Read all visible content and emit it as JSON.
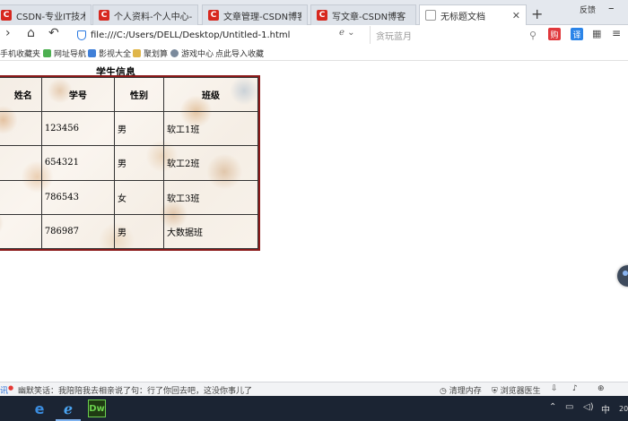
{
  "browser": {
    "tabs": [
      {
        "title": "CSDN-专业IT技术社区",
        "icon": "csdn-logo-icon",
        "active": false
      },
      {
        "title": "个人资料-个人中心-CSI",
        "icon": "csdn-logo-icon",
        "active": false
      },
      {
        "title": "文章管理-CSDN博客",
        "icon": "csdn-logo-icon",
        "active": false
      },
      {
        "title": "写文章-CSDN博客",
        "icon": "csdn-logo-icon",
        "active": false
      },
      {
        "title": "无标题文档",
        "icon": "document-icon",
        "active": true
      }
    ],
    "favicon_letter": "C",
    "new_tab_label": "+",
    "feedback_label": "反馈",
    "address": "file:///C:/Users/DELL/Desktop/Untitled-1.html",
    "search_placeholder": "贪玩蓝月",
    "ext_labels": [
      "购",
      "译"
    ],
    "accent_color": "#d7281f"
  },
  "bookmarks": [
    {
      "label": "手机收藏夹",
      "icon": "folder-icon"
    },
    {
      "label": "网址导航",
      "icon": "nav-icon"
    },
    {
      "label": "影视大全",
      "icon": "video-icon"
    },
    {
      "label": "聚划算",
      "icon": "shopping-icon"
    },
    {
      "label": "游戏中心",
      "icon": "game-icon"
    },
    {
      "label": "点此导入收藏",
      "icon": ""
    }
  ],
  "page": {
    "caption": "学生信息",
    "headers": [
      "姓名",
      "学号",
      "性别",
      "班级"
    ],
    "rows": [
      [
        "",
        "123456",
        "男",
        "软工1班"
      ],
      [
        "",
        "654321",
        "男",
        "软工2班"
      ],
      [
        "",
        "786543",
        "女",
        "软工3班"
      ],
      [
        "",
        "786987",
        "男",
        "大数据班"
      ]
    ],
    "border_color": "#8b1a1a"
  },
  "statusbar": {
    "news_label": "讯",
    "joke_text": "幽默笑话：我陪陪我去相亲说了句：行了你回去吧，这没你事儿了",
    "clean_memory": "清理内存",
    "browser_doctor": "浏览器医生"
  },
  "taskbar": {
    "apps": [
      "edge-icon",
      "ie-icon",
      "dreamweaver-icon"
    ],
    "dreamweaver_label": "Dw",
    "clock_partial": "20"
  }
}
